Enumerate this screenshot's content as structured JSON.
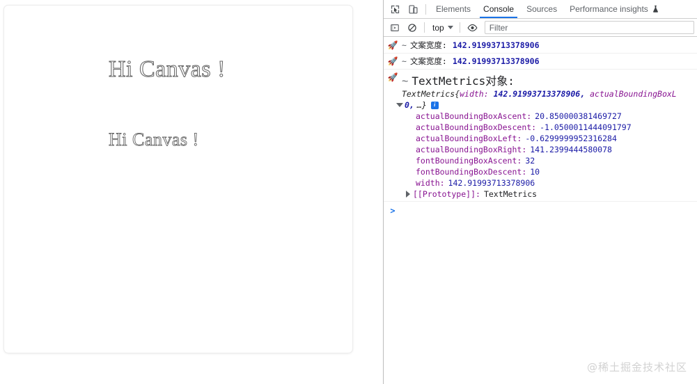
{
  "page": {
    "canvas": {
      "stroke_text_large": "Hi Canvas !",
      "stroke_text_small": "Hi Canvas !"
    }
  },
  "devtools": {
    "toolbar_icons": [
      {
        "name": "inspect-element-icon",
        "title": "Inspect element"
      },
      {
        "name": "device-toolbar-icon",
        "title": "Toggle device toolbar"
      }
    ],
    "tabs": [
      {
        "id": "elements",
        "label": "Elements",
        "active": false
      },
      {
        "id": "console",
        "label": "Console",
        "active": true
      },
      {
        "id": "sources",
        "label": "Sources",
        "active": false
      },
      {
        "id": "performance-insights",
        "label": "Performance insights",
        "active": false,
        "icon": "flask-icon"
      }
    ],
    "console_toolbar": {
      "sidebar_toggle_icon": "console-sidebar-icon",
      "clear_icon": "clear-console-icon",
      "context": "top",
      "eye_icon": "live-expression-eye-icon",
      "filter_placeholder": "Filter",
      "filter_value": ""
    },
    "messages": [
      {
        "icon": "rocket",
        "separator": "~",
        "label": "文案宽度:",
        "value": "142.91993713378906"
      },
      {
        "icon": "rocket",
        "separator": "~",
        "label": "文案宽度:",
        "value": "142.91993713378906"
      }
    ],
    "object_message": {
      "icon": "rocket",
      "separator": "~",
      "label": "TextMetrics对象:",
      "constructor": "TextMetrics",
      "preview_open": "{",
      "preview_key": "width:",
      "preview_value": "142.91993713378906,",
      "preview_trailing": "actualBoundingBoxL",
      "second_line_value": "0,",
      "second_line_ellipsis": "…}",
      "info_badge": "i",
      "properties": [
        {
          "key": "actualBoundingBoxAscent:",
          "value": "20.850000381469727"
        },
        {
          "key": "actualBoundingBoxDescent:",
          "value": "-1.0500011444091797"
        },
        {
          "key": "actualBoundingBoxLeft:",
          "value": "-0.6299999952316284"
        },
        {
          "key": "actualBoundingBoxRight:",
          "value": "141.2399444580078"
        },
        {
          "key": "fontBoundingBoxAscent:",
          "value": "32"
        },
        {
          "key": "fontBoundingBoxDescent:",
          "value": "10"
        },
        {
          "key": "width:",
          "value": "142.91993713378906"
        }
      ],
      "prototype_key": "[[Prototype]]:",
      "prototype_value": "TextMetrics"
    },
    "prompt": {
      "chevron": ">",
      "value": ""
    }
  },
  "watermark": {
    "text": "@稀土掘金技术社区"
  },
  "colors": {
    "accent_blue": "#1a73e8",
    "number_blue": "#1a1aa6",
    "property_purple": "#881391",
    "text_primary": "#202124",
    "text_secondary": "#5f6368",
    "border": "#cdcdcd",
    "watermark_gray": "#d2d2d2"
  }
}
